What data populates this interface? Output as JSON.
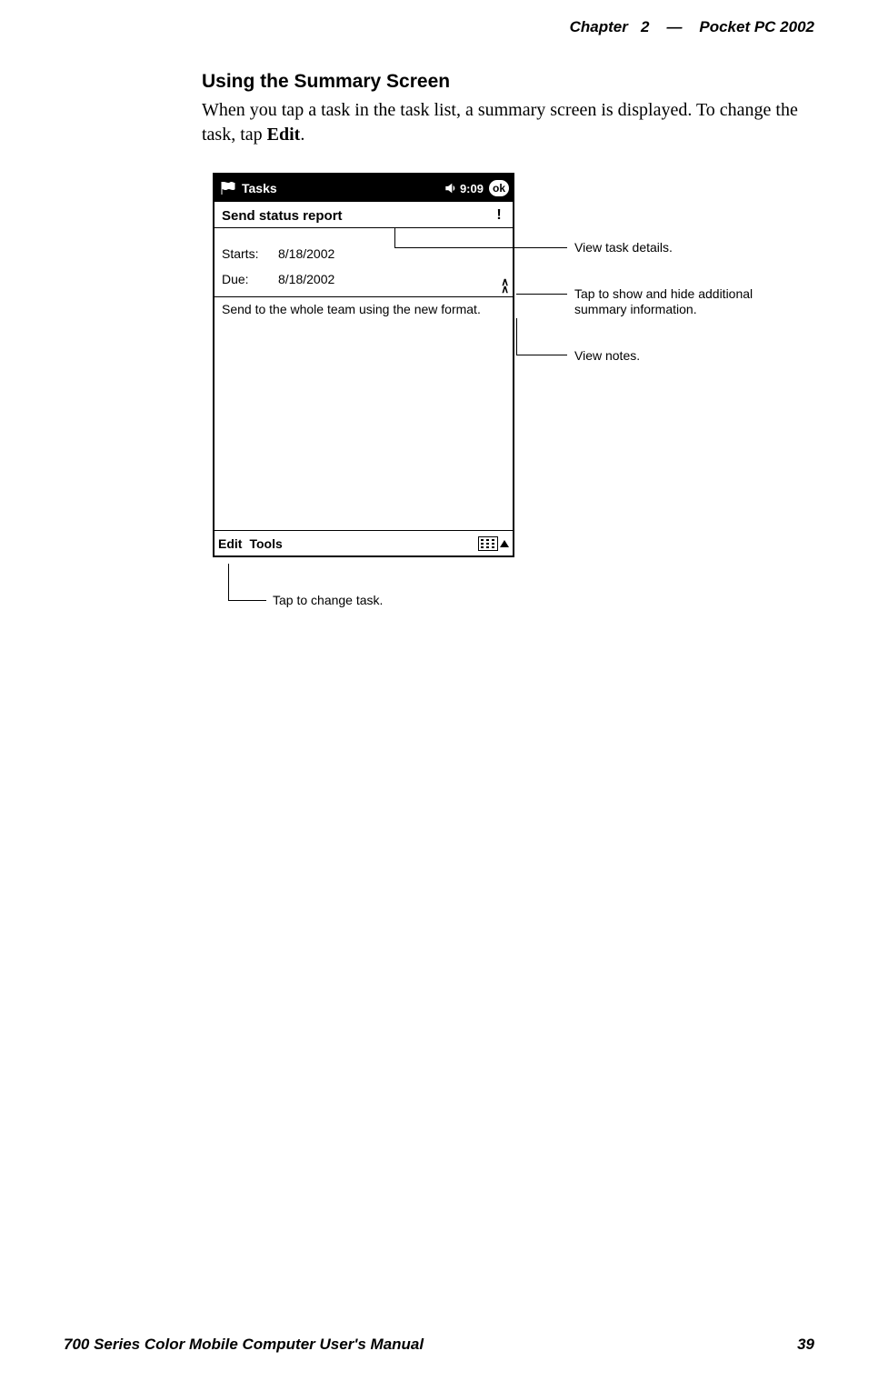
{
  "header": {
    "chapter_label": "Chapter",
    "chapter_num": "2",
    "dash": "—",
    "product": "Pocket PC 2002"
  },
  "section": {
    "heading": "Using the Summary Screen",
    "body_pre": "When you tap a task in the task list, a summary screen is displayed. To change the task, tap ",
    "body_bold": "Edit",
    "body_post": "."
  },
  "device": {
    "titlebar": {
      "app": "Tasks",
      "time": "9:09",
      "ok": "ok"
    },
    "task": {
      "name": "Send status report",
      "priority_icon_name": "priority-high-icon"
    },
    "details": {
      "starts_label": "Starts:",
      "starts_value": "8/18/2002",
      "due_label": "Due:",
      "due_value": "8/18/2002"
    },
    "notes": "Send to the whole team using the new format.",
    "bottombar": {
      "edit": "Edit",
      "tools": "Tools"
    }
  },
  "callouts": {
    "c1": "View task details.",
    "c2": "Tap to show and hide additional summary information.",
    "c3": "View notes.",
    "c4": "Tap to change task."
  },
  "footer": {
    "title": "700 Series Color Mobile Computer User's Manual",
    "page": "39"
  }
}
